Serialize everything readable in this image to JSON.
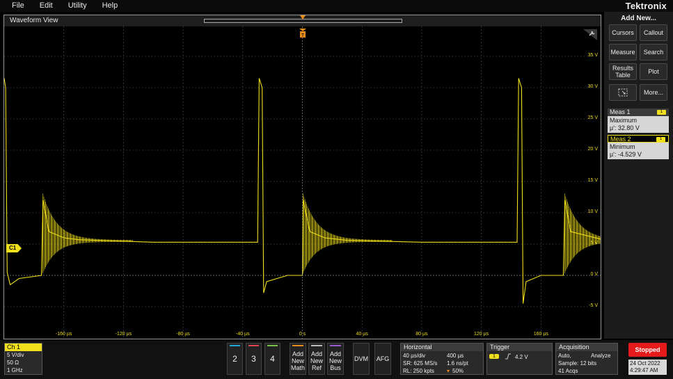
{
  "menu": [
    "File",
    "Edit",
    "Utility",
    "Help"
  ],
  "brand": "Tektronix",
  "waveform_view": {
    "title": "Waveform View",
    "trigger_position_label": "0",
    "trigger_marker_label": "T",
    "channel_badge": "C1",
    "y_axis_labels": [
      "35 V",
      "30 V",
      "25 V",
      "20 V",
      "15 V",
      "10 V",
      "5 V",
      "0 V",
      "-5 V"
    ],
    "x_axis_labels": [
      "-160 µs",
      "-120 µs",
      "-80 µs",
      "-40 µs",
      "0 s",
      "40 µs",
      "80 µs",
      "120 µs",
      "160 µs"
    ],
    "trace_color": "#f0df1b"
  },
  "chart_data": {
    "type": "line",
    "title": "",
    "xlabel": "",
    "ylabel": "",
    "xlim": [
      -200,
      200
    ],
    "ylim": [
      -10,
      40
    ],
    "x_unit": "µs",
    "y_unit": "V",
    "series": [
      {
        "description_points": [
          [
            -200,
            31.5
          ],
          [
            -199,
            30.0
          ],
          [
            -198,
            0.5
          ],
          [
            -196,
            -1.5
          ],
          [
            -190,
            -0.5
          ],
          [
            -175,
            0
          ],
          [
            -174,
            12.0
          ],
          [
            -170,
            7.0
          ],
          [
            -160,
            6.0
          ],
          [
            -150,
            5.7
          ],
          [
            -100,
            5.3
          ],
          [
            -30,
            5.3
          ],
          [
            -29,
            31.5
          ],
          [
            -27,
            30.0
          ],
          [
            -26,
            -2.8
          ],
          [
            -24,
            -1.0
          ],
          [
            -10,
            0
          ],
          [
            0,
            0
          ],
          [
            0.5,
            12.0
          ],
          [
            5,
            7.0
          ],
          [
            15,
            6.0
          ],
          [
            30,
            5.6
          ],
          [
            80,
            5.3
          ],
          [
            144,
            5.3
          ],
          [
            145,
            31.5
          ],
          [
            147,
            30.0
          ],
          [
            148,
            -4.5
          ],
          [
            150,
            -1.0
          ],
          [
            160,
            0
          ],
          [
            175,
            0
          ],
          [
            176,
            12.0
          ],
          [
            180,
            7.0
          ],
          [
            200,
            5.8
          ]
        ]
      }
    ]
  },
  "right_panel": {
    "title": "Add New...",
    "buttons": [
      "Cursors",
      "Callout",
      "Measure",
      "Search",
      "Results Table",
      "Plot",
      "More..."
    ],
    "meas1": {
      "label": "Meas 1",
      "badge": "1",
      "name": "Maximum",
      "value": "µ': 32.80 V"
    },
    "meas2": {
      "label": "Meas 2",
      "badge": "1",
      "name": "Minimum",
      "value": "µ': -4.529 V"
    }
  },
  "bottom": {
    "ch1": {
      "label": "Ch 1",
      "scale": "5 V/div",
      "impedance": "50 Ω",
      "bandwidth": "1 GHz"
    },
    "channels": [
      "2",
      "3",
      "4"
    ],
    "channel_colors": [
      "#22a8d8",
      "#e0424f",
      "#7ac143"
    ],
    "add_math": "Add New Math",
    "add_ref": "Add New Ref",
    "add_bus": "Add New Bus",
    "dvm": "DVM",
    "afg": "AFG",
    "horizontal": {
      "title": "Horizontal",
      "scale": "40 µs/div",
      "record": "400 µs",
      "sample_rate": "SR: 625 MS/s",
      "resolution": "1.6 ns/pt",
      "record_length": "RL: 250 kpts",
      "position": "50%"
    },
    "trigger": {
      "title": "Trigger",
      "source": "1",
      "level": "4.2 V"
    },
    "acquisition": {
      "title": "Acquisition",
      "mode": "Auto,",
      "type": "Analyze",
      "sample": "Sample: 12 bits",
      "acqs": "41 Acqs"
    },
    "status": "Stopped",
    "date": "24 Oct 2022",
    "time": "4:29:47 AM"
  }
}
